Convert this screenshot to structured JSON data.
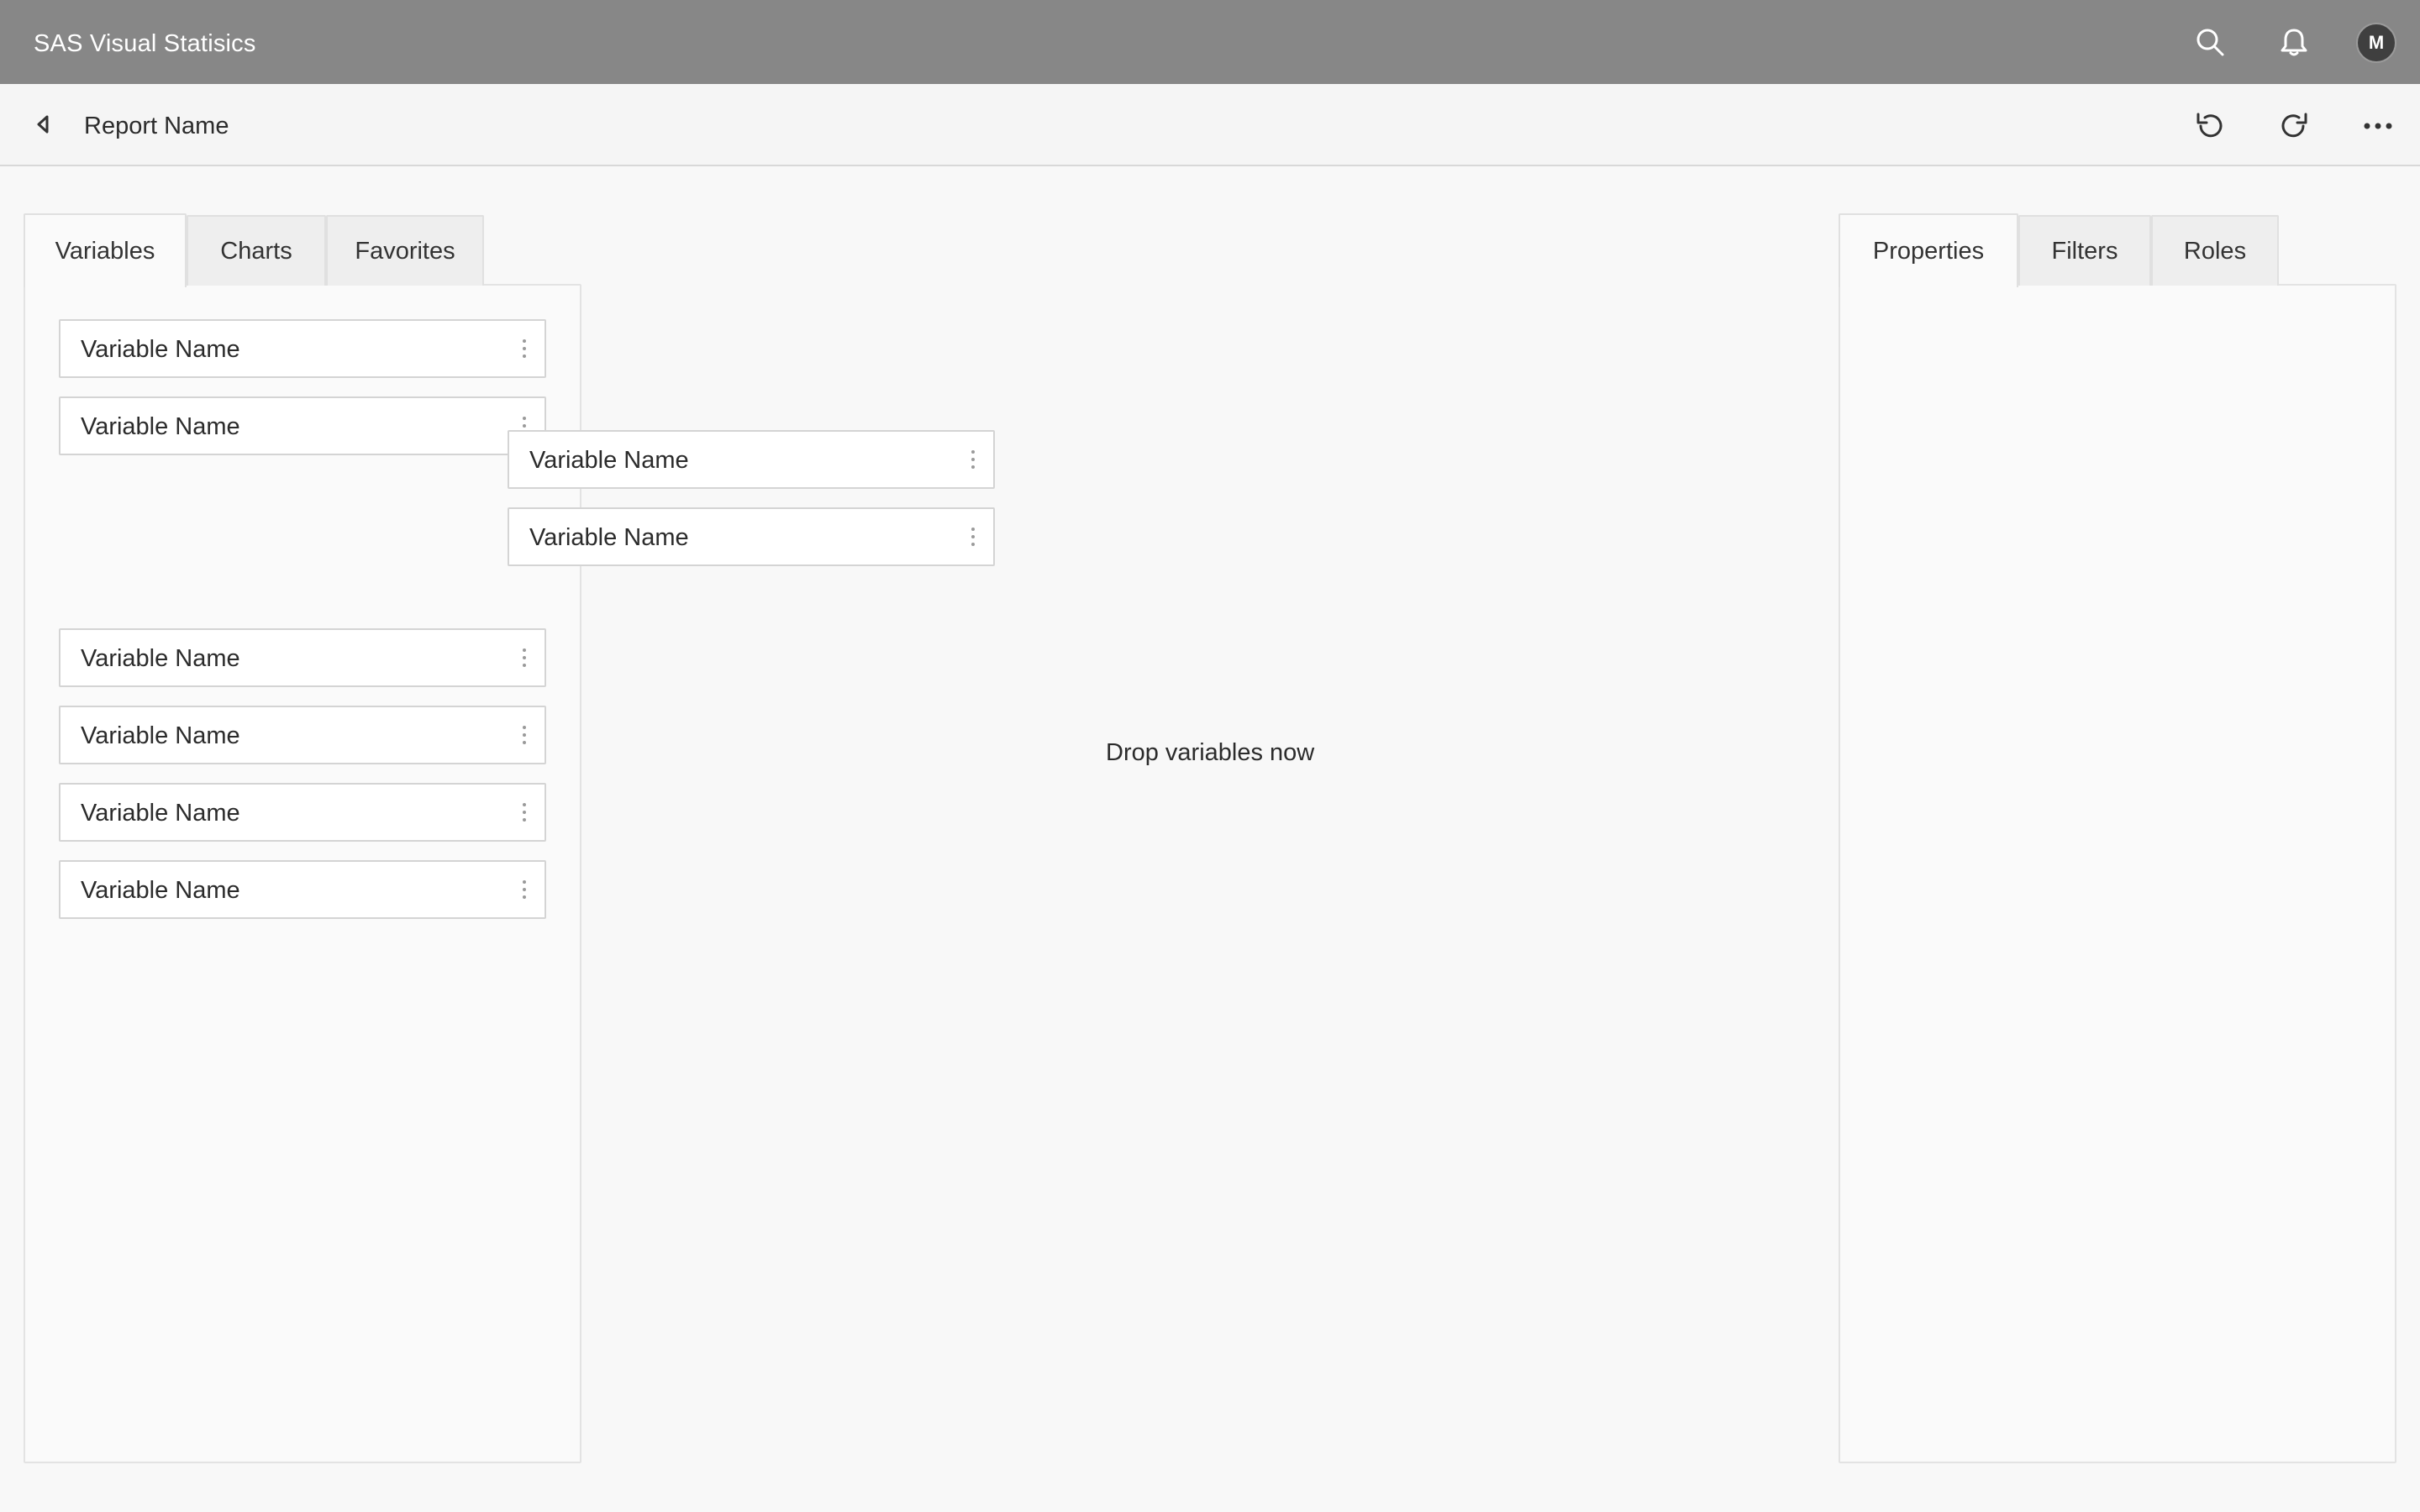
{
  "app": {
    "title": "SAS Visual Statisics",
    "avatar_initial": "M",
    "icons": [
      "search-icon",
      "bell-icon",
      "avatar"
    ]
  },
  "toolbar": {
    "back_icon": "back-caret-icon",
    "report_name": "Report Name",
    "icons": [
      "undo-icon",
      "redo-icon",
      "more-icon"
    ]
  },
  "left_tabs": [
    {
      "label": "Variables",
      "active": true
    },
    {
      "label": "Charts",
      "active": false
    },
    {
      "label": "Favorites",
      "active": false
    }
  ],
  "right_tabs": [
    {
      "label": "Properties",
      "active": true
    },
    {
      "label": "Filters",
      "active": false
    },
    {
      "label": "Roles",
      "active": false
    }
  ],
  "variables": [
    {
      "label": "Variable Name"
    },
    {
      "label": "Variable Name"
    },
    {
      "label": "Variable Name"
    },
    {
      "label": "Variable Name"
    },
    {
      "label": "Variable Name"
    },
    {
      "label": "Variable Name"
    }
  ],
  "dragged_variables": [
    {
      "label": "Variable Name"
    },
    {
      "label": "Variable Name"
    }
  ],
  "canvas": {
    "drop_hint": "Drop variables now"
  },
  "colors": {
    "appbar": "#878787",
    "background": "#f8f8f8",
    "avatar": "#3f3f3f"
  }
}
